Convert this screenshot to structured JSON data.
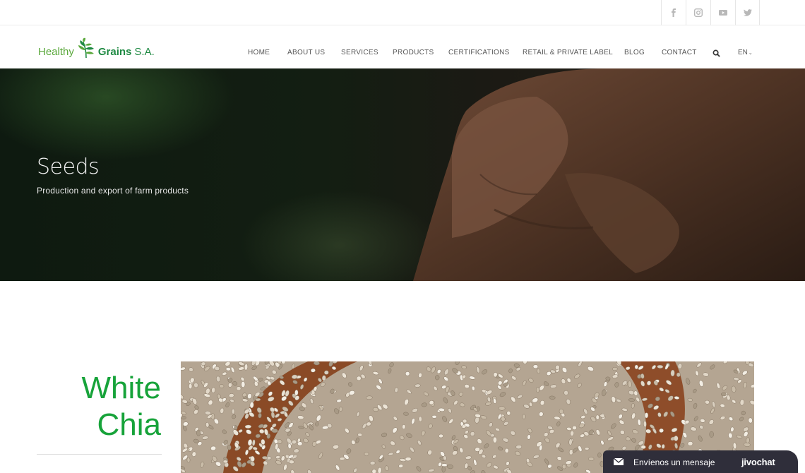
{
  "social": [
    "facebook-icon",
    "instagram-icon",
    "youtube-icon",
    "twitter-icon"
  ],
  "logo": {
    "healthy": "Healthy",
    "grains": "Grains",
    "sa": "S.A."
  },
  "nav": {
    "items": [
      "HOME",
      "ABOUT US",
      "SERVICES",
      "PRODUCTS",
      "CERTIFICATIONS",
      "RETAIL & PRIVATE LABEL",
      "BLOG",
      "CONTACT"
    ],
    "search_icon": "search-icon",
    "lang": "EN"
  },
  "hero": {
    "title": "Seeds",
    "subtitle": "Production and export of farm products"
  },
  "product": {
    "title_line1": "White",
    "title_line2": "Chia"
  },
  "chat": {
    "label": "Envíenos un mensaje",
    "brand": "jivochat"
  },
  "colors": {
    "brand_green": "#17a33a",
    "logo_green": "#5aa83b",
    "chat_bg": "#2f2e3a"
  }
}
